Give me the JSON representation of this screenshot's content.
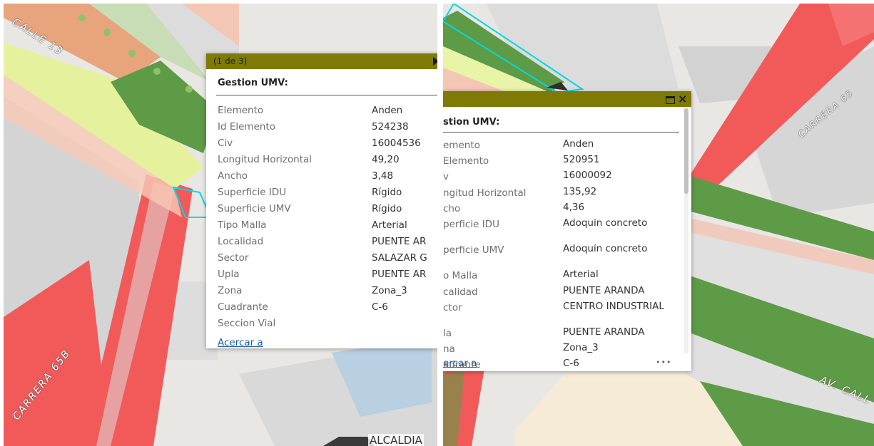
{
  "left": {
    "street_labels": {
      "calle13": "CALLE 13",
      "carrera65b": "CARRERA 65B"
    },
    "footer_text": "ALCALDIA",
    "popup": {
      "pager": "(1 de 3)",
      "title": "Gestion UMV:",
      "rows": [
        {
          "key": "Elemento",
          "value": "Anden"
        },
        {
          "key": "Id Elemento",
          "value": "524238"
        },
        {
          "key": "Civ",
          "value": "16004536"
        },
        {
          "key": "Longitud Horizontal",
          "value": "49,20"
        },
        {
          "key": "Ancho",
          "value": "3,48"
        },
        {
          "key": "Superficie IDU",
          "value": "Rígido"
        },
        {
          "key": "Superficie UMV",
          "value": "Rígido"
        },
        {
          "key": "Tipo Malla",
          "value": "Arterial"
        },
        {
          "key": "Localidad",
          "value": "PUENTE AR"
        },
        {
          "key": "Sector",
          "value": "SALAZAR G"
        },
        {
          "key": "Upla",
          "value": "PUENTE AR"
        },
        {
          "key": "Zona",
          "value": "Zona_3"
        },
        {
          "key": "Cuadrante",
          "value": "C-6"
        },
        {
          "key": "Seccion Vial",
          "value": ""
        }
      ],
      "zoom_link": "Acercar a"
    }
  },
  "right": {
    "street_labels": {
      "carrera65": "CARRERA 65",
      "av_calle": "AV. CALL"
    },
    "popup": {
      "title": "stion UMV:",
      "rows": [
        {
          "key": "emento",
          "value": "Anden"
        },
        {
          "key": "Elemento",
          "value": "520951"
        },
        {
          "key": "v",
          "value": "16000092"
        },
        {
          "key": "ngitud Horizontal",
          "value": "135,92"
        },
        {
          "key": "cho",
          "value": "4,36"
        },
        {
          "key": "perficie IDU",
          "value": "Adoquín concreto"
        },
        {
          "key": "perficie UMV",
          "value": "Adoquín concreto"
        },
        {
          "key": "o Malla",
          "value": "Arterial"
        },
        {
          "key": "calidad",
          "value": "PUENTE ARANDA"
        },
        {
          "key": "ctor",
          "value": "CENTRO INDUSTRIAL"
        },
        {
          "key": "la",
          "value": "PUENTE ARANDA"
        },
        {
          "key": "na",
          "value": "Zona_3"
        },
        {
          "key": "adrante",
          "value": "C-6"
        }
      ],
      "zoom_link": "ercar a",
      "more_label": "•••"
    }
  },
  "colors": {
    "header": "#7d7a05",
    "red_road": "#f25a5a",
    "green_road": "#5e9b46",
    "highlight": "#00d8e8",
    "link": "#1c5ea8"
  }
}
